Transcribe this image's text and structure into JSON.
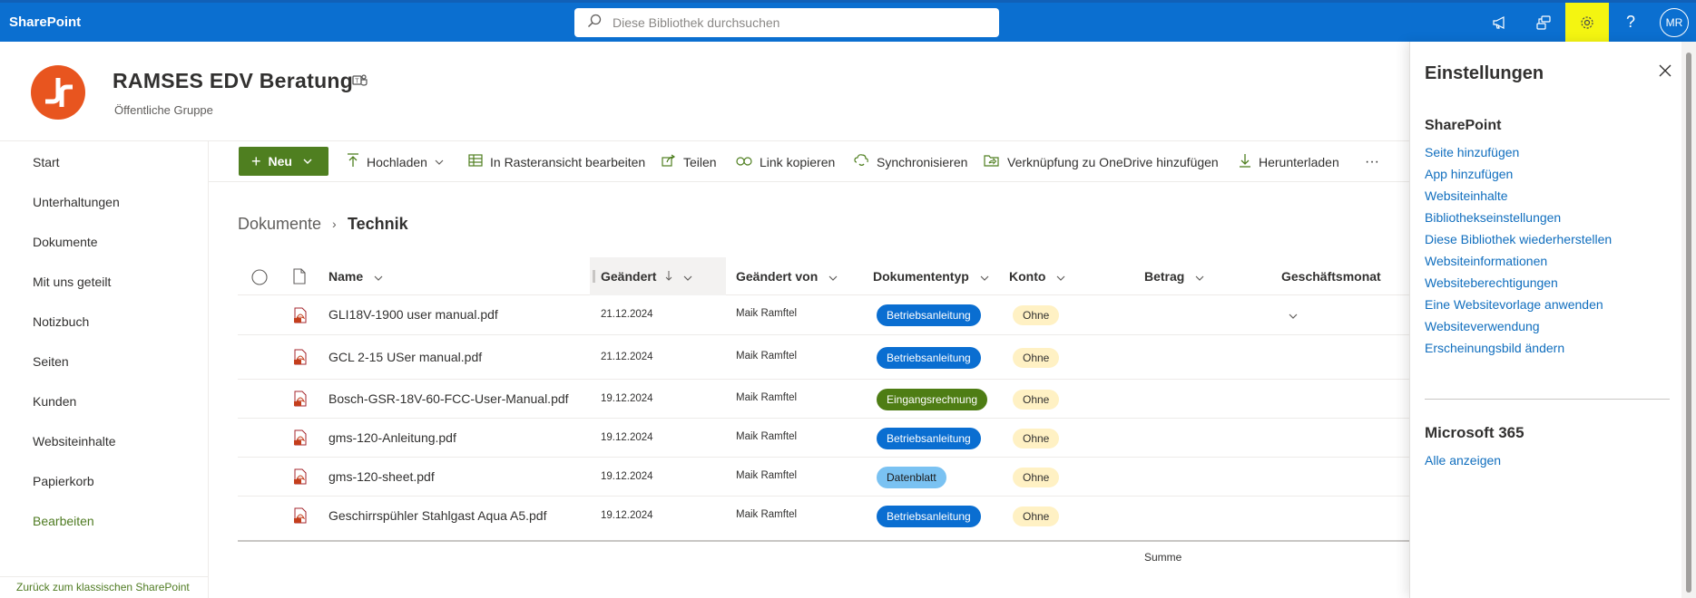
{
  "suite": {
    "brand": "SharePoint",
    "search_placeholder": "Diese Bibliothek durchsuchen",
    "avatar_initials": "MR",
    "icons": [
      "megaphone-icon",
      "connections-icon",
      "gear-icon",
      "help-icon"
    ]
  },
  "site": {
    "title": "RAMSES EDV Beratung",
    "subtitle": "Öffentliche Gruppe",
    "logo_color": "#e8551f"
  },
  "nav": {
    "items": [
      "Start",
      "Unterhaltungen",
      "Dokumente",
      "Mit uns geteilt",
      "Notizbuch",
      "Seiten",
      "Kunden",
      "Websiteinhalte",
      "Papierkorb"
    ],
    "edit_label": "Bearbeiten",
    "footer_link": "Zurück zum klassischen SharePoint"
  },
  "commandbar": {
    "new_label": "Neu",
    "upload": "Hochladen",
    "grid_edit": "In Rasteransicht bearbeiten",
    "share": "Teilen",
    "copy_link": "Link kopieren",
    "sync": "Synchronisieren",
    "onedrive_shortcut": "Verknüpfung zu OneDrive hinzufügen",
    "download": "Herunterladen",
    "more": "···"
  },
  "breadcrumb": {
    "root": "Dokumente",
    "separator": "›",
    "current": "Technik"
  },
  "list": {
    "columns": {
      "name": "Name",
      "modified": "Geändert",
      "modified_by": "Geändert von",
      "doctype": "Dokumententyp",
      "konto": "Konto",
      "betrag": "Betrag",
      "month": "Geschäftsmonat"
    },
    "rows": [
      {
        "name": "GLI18V-1900 user manual.pdf",
        "modified": "21.12.2024",
        "by": "Maik Ramftel",
        "doctype": "Betriebsanleitung",
        "konto": "Ohne"
      },
      {
        "name": "GCL 2-15 USer manual.pdf",
        "modified": "21.12.2024",
        "by": "Maik Ramftel",
        "doctype": "Betriebsanleitung",
        "konto": "Ohne"
      },
      {
        "name": "Bosch-GSR-18V-60-FCC-User-Manual.pdf",
        "modified": "19.12.2024",
        "by": "Maik Ramftel",
        "doctype": "Eingangsrechnung",
        "konto": "Ohne"
      },
      {
        "name": "gms-120-Anleitung.pdf",
        "modified": "19.12.2024",
        "by": "Maik Ramftel",
        "doctype": "Betriebsanleitung",
        "konto": "Ohne"
      },
      {
        "name": "gms-120-sheet.pdf",
        "modified": "19.12.2024",
        "by": "Maik Ramftel",
        "doctype": "Datenblatt",
        "konto": "Ohne"
      },
      {
        "name": "Geschirrspühler Stahlgast Aqua A5.pdf",
        "modified": "19.12.2024",
        "by": "Maik Ramftel",
        "doctype": "Betriebsanleitung",
        "konto": "Ohne"
      }
    ],
    "sum_label": "Summe"
  },
  "settings_panel": {
    "title": "Einstellungen",
    "section_sharepoint": "SharePoint",
    "links": [
      "Seite hinzufügen",
      "App hinzufügen",
      "Websiteinhalte",
      "Bibliothekseinstellungen",
      "Diese Bibliothek wiederherstellen",
      "Websiteinformationen",
      "Websiteberechtigungen",
      "Eine Websitevorlage anwenden",
      "Websiteverwendung",
      "Erscheinungsbild ändern"
    ],
    "section_m365": "Microsoft 365",
    "m365_link": "Alle anzeigen"
  },
  "colors": {
    "suite_bar": "#0b6fd0",
    "accent_green": "#4f7f20",
    "pill_blue": "#0a6ed1",
    "pill_green": "#4e7d14",
    "pill_light": "#7ac2f2",
    "pill_ohne": "#fff1c4",
    "gear_highlight": "#f4f511"
  }
}
